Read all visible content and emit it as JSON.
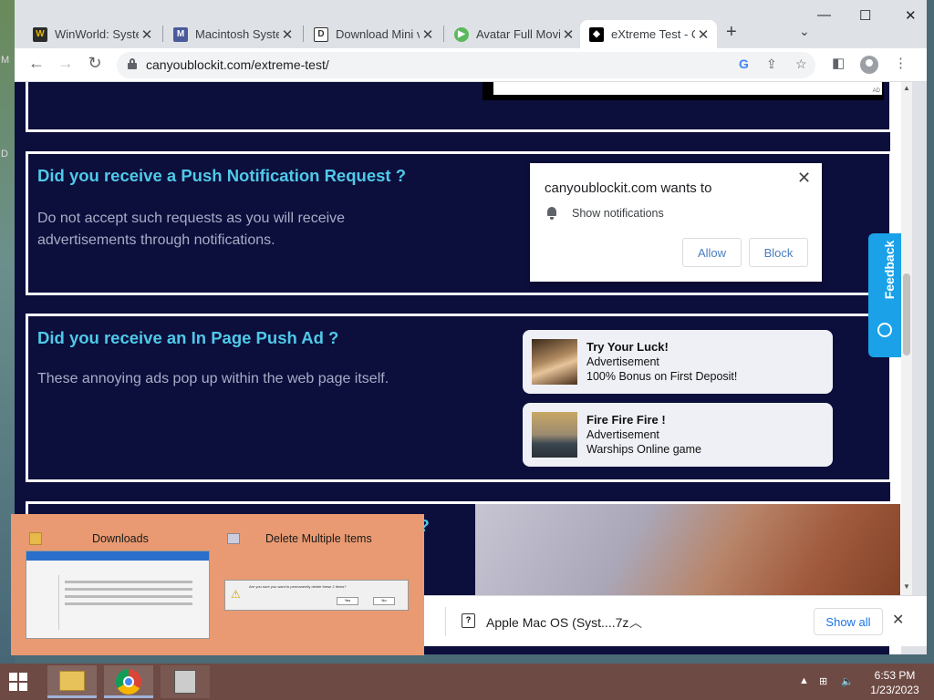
{
  "desktop": {
    "left_letters": [
      "M",
      "D"
    ]
  },
  "browser": {
    "tabs": [
      {
        "title": "WinWorld: System",
        "favicon": "W",
        "color": "#2b2b2b",
        "active": false
      },
      {
        "title": "Macintosh System",
        "favicon": "M",
        "color": "#4a5a9a",
        "active": false
      },
      {
        "title": "Download Mini v",
        "favicon": "D",
        "color": "#333333",
        "active": false
      },
      {
        "title": "Avatar Full Movie",
        "favicon": "▶",
        "color": "#5cb85c",
        "active": false
      },
      {
        "title": "eXtreme Test - C",
        "favicon": "◆",
        "color": "#000000",
        "active": true
      }
    ],
    "new_tab": "+",
    "tab_search": "⌄",
    "url": "canyoublockit.com/extreme-test/",
    "window_controls": {
      "minimize": "—",
      "maximize": "☐",
      "close": "✕"
    }
  },
  "page": {
    "push_section": {
      "heading": "Did you receive a Push Notification Request ?",
      "body": "Do not accept such requests as you will receive advertisements through notifications.",
      "dialog": {
        "site": "canyoublockit.com wants to",
        "permission": "Show notifications",
        "allow": "Allow",
        "block": "Block",
        "close": "✕"
      }
    },
    "inpage_section": {
      "heading": "Did you receive an In Page Push Ad ?",
      "body": "These annoying ads pop up within the web page itself.",
      "ads": [
        {
          "title": "Try Your Luck!",
          "label": "Advertisement",
          "text": "100% Bonus on First Deposit!"
        },
        {
          "title": "Fire Fire Fire !",
          "label": "Advertisement",
          "text": "Warships Online game"
        }
      ]
    },
    "video_section": {
      "heading_tail": "o ?"
    },
    "top_ad_mark": "AD",
    "feedback": "Feedback"
  },
  "downloads": {
    "item_name": "Apple Mac OS (Syst....7z",
    "show_all": "Show all",
    "close": "✕"
  },
  "taskbar_preview": {
    "window1_title": "Downloads",
    "window2_title": "Delete Multiple Items",
    "dialog_text": "Are you sure you want to permanently delete these 2 items?",
    "dialog_yes": "Yes",
    "dialog_no": "No"
  },
  "clock": {
    "time": "6:53 PM",
    "date": "1/23/2023"
  }
}
